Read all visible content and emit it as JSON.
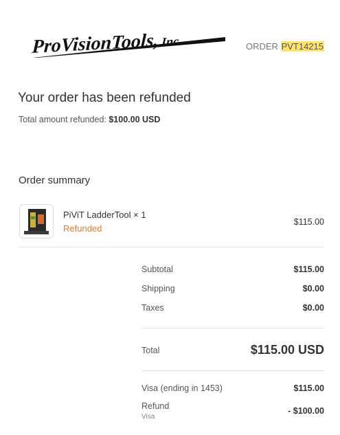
{
  "header": {
    "logo_text": "ProVisionTools, Inc.",
    "order_prefix": "ORDER",
    "order_number": "PVT14215"
  },
  "status": {
    "headline": "Your order has been refunded",
    "refund_label": "Total amount refunded:",
    "refund_amount": "$100.00 USD"
  },
  "summary": {
    "title": "Order summary",
    "item": {
      "name": "PiViT LadderTool × 1",
      "status": "Refunded",
      "price": "$115.00"
    },
    "subtotal_label": "Subtotal",
    "subtotal_value": "$115.00",
    "shipping_label": "Shipping",
    "shipping_value": "$0.00",
    "taxes_label": "Taxes",
    "taxes_value": "$0.00",
    "total_label": "Total",
    "total_value": "$115.00 USD",
    "payment_label": "Visa (ending in 1453)",
    "payment_value": "$115.00",
    "refund_label": "Refund",
    "refund_method": "Visa",
    "refund_value": "- $100.00"
  },
  "colors": {
    "order_highlight": "#ffe36e",
    "refunded_status": "#e07a3a"
  }
}
